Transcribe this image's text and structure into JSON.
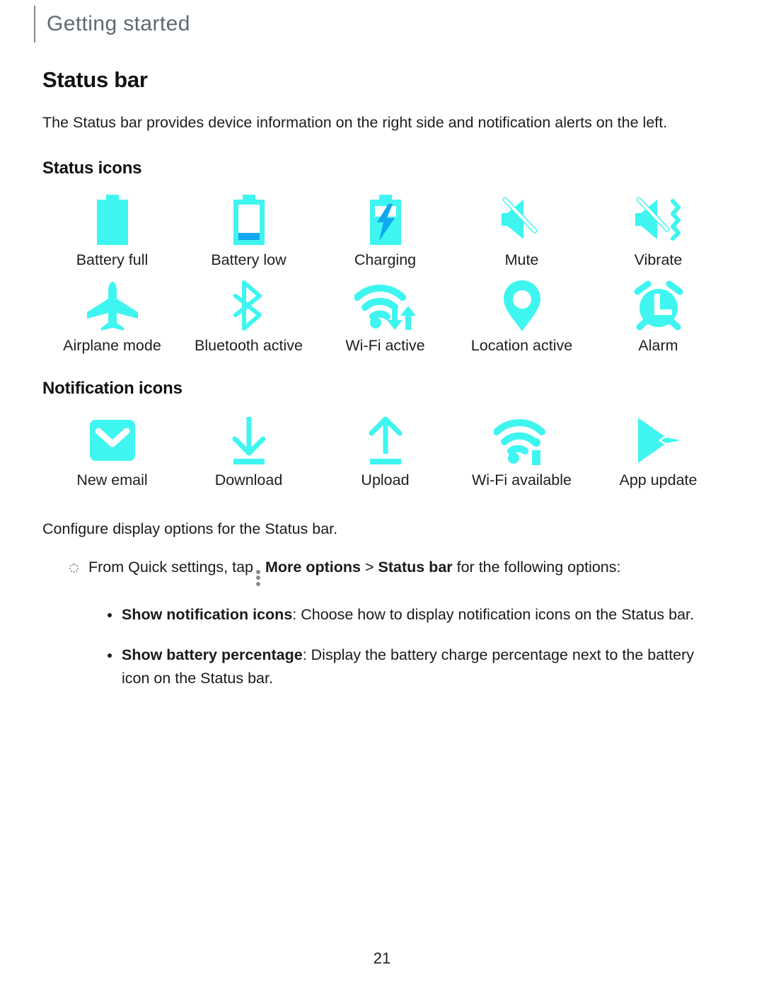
{
  "header": {
    "title": "Getting started"
  },
  "page": {
    "number": "21"
  },
  "section": {
    "title": "Status bar",
    "intro": "The Status bar provides device information on the right side and notification alerts on the left."
  },
  "colors": {
    "icon_cyan": "#3FF5F0",
    "icon_blue": "#10A8F0",
    "header_gray": "#5D6A71",
    "rule_gray": "#7D8A91",
    "text": "#1E1E1E"
  },
  "status_icons": {
    "heading": "Status icons",
    "items": [
      {
        "icon": "battery-full-icon",
        "label": "Battery full"
      },
      {
        "icon": "battery-low-icon",
        "label": "Battery low"
      },
      {
        "icon": "battery-charging-icon",
        "label": "Charging"
      },
      {
        "icon": "mute-icon",
        "label": "Mute"
      },
      {
        "icon": "vibrate-icon",
        "label": "Vibrate"
      },
      {
        "icon": "airplane-mode-icon",
        "label": "Airplane mode"
      },
      {
        "icon": "bluetooth-active-icon",
        "label": "Bluetooth active"
      },
      {
        "icon": "wifi-active-icon",
        "label": "Wi-Fi active"
      },
      {
        "icon": "location-active-icon",
        "label": "Location active"
      },
      {
        "icon": "alarm-icon",
        "label": "Alarm"
      }
    ]
  },
  "notification_icons": {
    "heading": "Notification icons",
    "items": [
      {
        "icon": "new-email-icon",
        "label": "New email"
      },
      {
        "icon": "download-icon",
        "label": "Download"
      },
      {
        "icon": "upload-icon",
        "label": "Upload"
      },
      {
        "icon": "wifi-available-icon",
        "label": "Wi-Fi available"
      },
      {
        "icon": "app-update-icon",
        "label": "App update"
      }
    ]
  },
  "instructions": {
    "configure_line": "Configure display options for the Status bar.",
    "quick_settings": {
      "before_kebab": "From Quick settings, tap",
      "more_options": "More options",
      "separator": ">",
      "status_bar": "Status bar",
      "after": "for the following options:"
    },
    "options": [
      {
        "name": "Show notification icons",
        "description": ": Choose how to display notification icons on the Status bar."
      },
      {
        "name": "Show battery percentage",
        "description": ": Display the battery charge percentage next to the battery icon on the Status bar."
      }
    ]
  }
}
